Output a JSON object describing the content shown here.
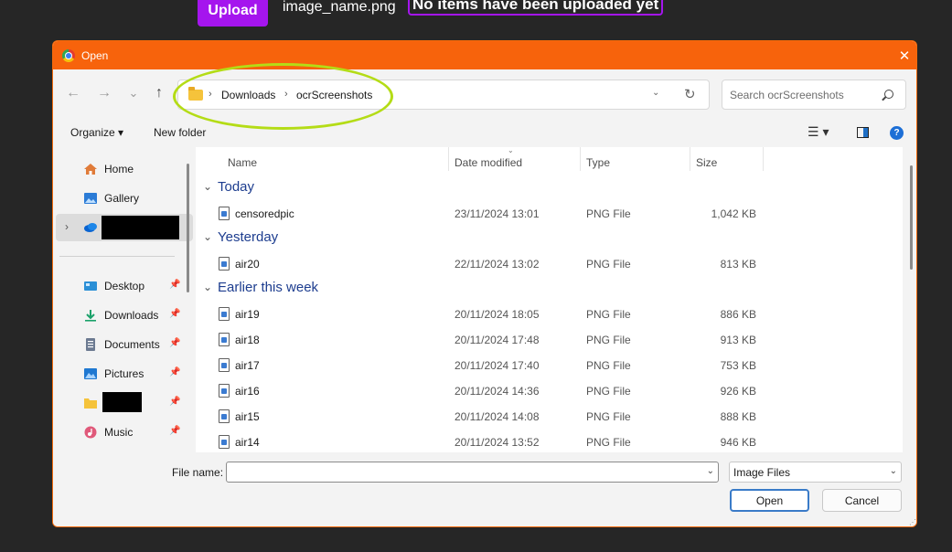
{
  "background_page": {
    "upload_label": "Upload",
    "file_name": "image_name.png",
    "empty_message": "No items have been uploaded yet"
  },
  "dialog": {
    "title": "Open",
    "close_glyph": "✕",
    "accent_color": "#f7630c"
  },
  "nav": {
    "back_glyph": "←",
    "forward_glyph": "→",
    "recent_glyph": "⌄",
    "up_glyph": "↑",
    "breadcrumb": [
      "Downloads",
      "ocrScreenshots"
    ],
    "breadcrumb_sep": "›",
    "address_dropdown_glyph": "⌄",
    "refresh_glyph": "↻",
    "search_placeholder": "Search ocrScreenshots"
  },
  "command_bar": {
    "organize_label": "Organize ▾",
    "new_folder_label": "New folder",
    "view_glyph": "☰ ▾",
    "help_glyph": "?"
  },
  "nav_pane": {
    "items": [
      {
        "label": "Home",
        "icon": "home-icon",
        "pinned": false
      },
      {
        "label": "Gallery",
        "icon": "gallery-icon",
        "pinned": false
      },
      {
        "label": "",
        "icon": "onedrive-icon",
        "pinned": false,
        "redacted": true
      },
      {
        "label": "Desktop",
        "icon": "desktop-icon",
        "pinned": true
      },
      {
        "label": "Downloads",
        "icon": "download-icon",
        "pinned": true
      },
      {
        "label": "Documents",
        "icon": "documents-icon",
        "pinned": true
      },
      {
        "label": "Pictures",
        "icon": "pictures-icon",
        "pinned": true
      },
      {
        "label": "",
        "icon": "folder-icon",
        "pinned": true,
        "redacted": true
      },
      {
        "label": "Music",
        "icon": "music-icon",
        "pinned": true
      }
    ],
    "pin_glyph": "📌",
    "expand_glyph": "›"
  },
  "file_list": {
    "columns": [
      "Name",
      "Date modified",
      "Type",
      "Size"
    ],
    "sort_glyph": "⌄",
    "group_glyph": "⌄",
    "groups": [
      {
        "label": "Today",
        "rows": [
          {
            "name": "censoredpic",
            "date": "23/11/2024 13:01",
            "type": "PNG File",
            "size": "1,042 KB"
          }
        ]
      },
      {
        "label": "Yesterday",
        "rows": [
          {
            "name": "air20",
            "date": "22/11/2024 13:02",
            "type": "PNG File",
            "size": "813 KB"
          }
        ]
      },
      {
        "label": "Earlier this week",
        "rows": [
          {
            "name": "air19",
            "date": "20/11/2024 18:05",
            "type": "PNG File",
            "size": "886 KB"
          },
          {
            "name": "air18",
            "date": "20/11/2024 17:48",
            "type": "PNG File",
            "size": "913 KB"
          },
          {
            "name": "air17",
            "date": "20/11/2024 17:40",
            "type": "PNG File",
            "size": "753 KB"
          },
          {
            "name": "air16",
            "date": "20/11/2024 14:36",
            "type": "PNG File",
            "size": "926 KB"
          },
          {
            "name": "air15",
            "date": "20/11/2024 14:08",
            "type": "PNG File",
            "size": "888 KB"
          },
          {
            "name": "air14",
            "date": "20/11/2024 13:52",
            "type": "PNG File",
            "size": "946 KB"
          }
        ]
      }
    ]
  },
  "footer": {
    "file_name_label": "File name:",
    "file_name_value": "",
    "dropdown_glyph": "⌄",
    "file_type": "Image Files",
    "open_label": "Open",
    "cancel_label": "Cancel",
    "grip_glyph": "⋰"
  }
}
